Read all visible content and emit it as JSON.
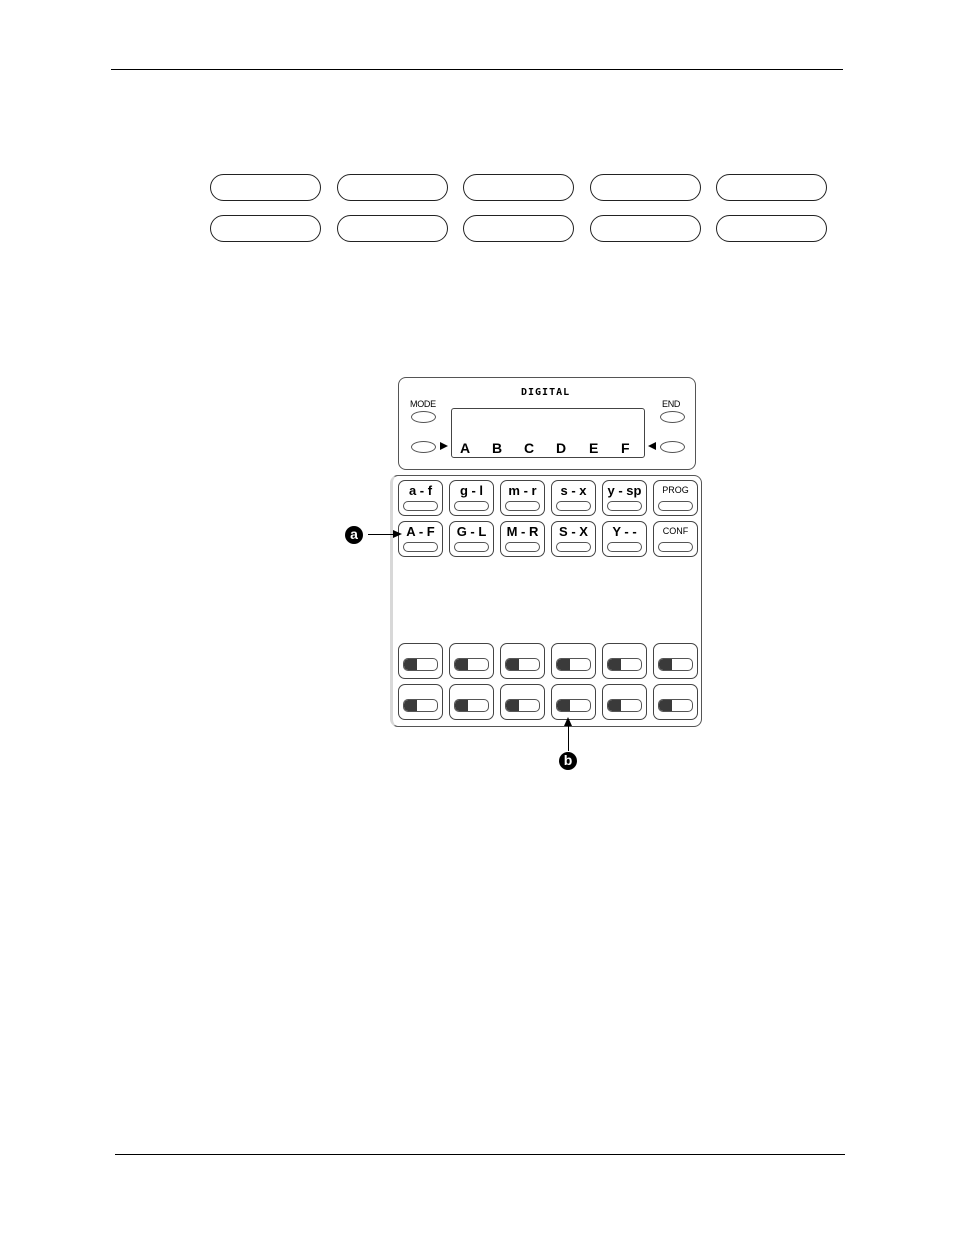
{
  "page": {
    "header_rule": true,
    "footer_rule": true
  },
  "button_strip": {
    "rows": [
      {
        "ovals": [
          "",
          "",
          "",
          "",
          ""
        ]
      },
      {
        "ovals": [
          "",
          "",
          "",
          "",
          ""
        ]
      }
    ]
  },
  "phone": {
    "brand": "DIGITAL",
    "mode_label": "MODE",
    "end_label": "END",
    "lcd_chars": [
      "A",
      "B",
      "C",
      "D",
      "E",
      "F"
    ],
    "keys_row1": [
      "a - f",
      "g - l",
      "m - r",
      "s - x",
      "y - sp",
      "PROG"
    ],
    "keys_row2": [
      "A - F",
      "G - L",
      "M - R",
      "S - X",
      "Y - -",
      "CONF"
    ],
    "led_rows": 2,
    "led_cols": 6
  },
  "callouts": {
    "a": "a",
    "b": "b"
  }
}
